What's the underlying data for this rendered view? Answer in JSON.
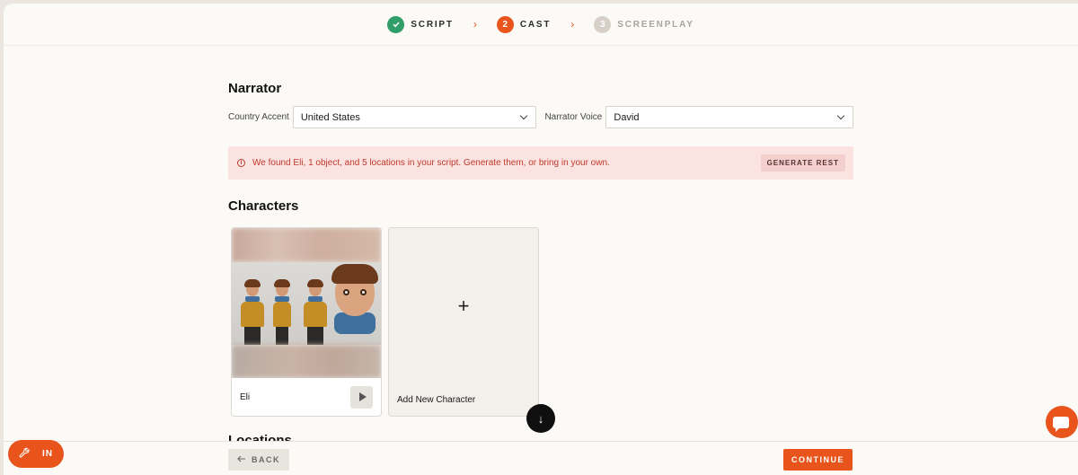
{
  "stepper": {
    "steps": [
      {
        "number": "",
        "label": "SCRIPT",
        "state": "done"
      },
      {
        "number": "2",
        "label": "CAST",
        "state": "active"
      },
      {
        "number": "3",
        "label": "SCREENPLAY",
        "state": "todo"
      }
    ],
    "separator": "›"
  },
  "narrator": {
    "title": "Narrator",
    "country_label": "Country Accent",
    "country_value": "United States",
    "voice_label": "Narrator Voice",
    "voice_value": "David"
  },
  "alert": {
    "icon": "info-icon",
    "text": "We found Eli, 1 object, and 5 locations in your script. Generate them, or bring in your own.",
    "action": "GENERATE REST"
  },
  "characters": {
    "title": "Characters",
    "items": [
      {
        "name": "Eli"
      }
    ],
    "add_label": "Add New Character",
    "add_symbol": "+"
  },
  "locations": {
    "title": "Locations"
  },
  "scroll_down_symbol": "↓",
  "footer": {
    "back_label": "BACK",
    "continue_label": "CONTINUE"
  },
  "floating": {
    "in_label": "IN"
  },
  "colors": {
    "accent": "#e8541c",
    "success": "#2f9e68",
    "alert_bg": "#fbe3e2",
    "alert_text": "#c0392b"
  }
}
